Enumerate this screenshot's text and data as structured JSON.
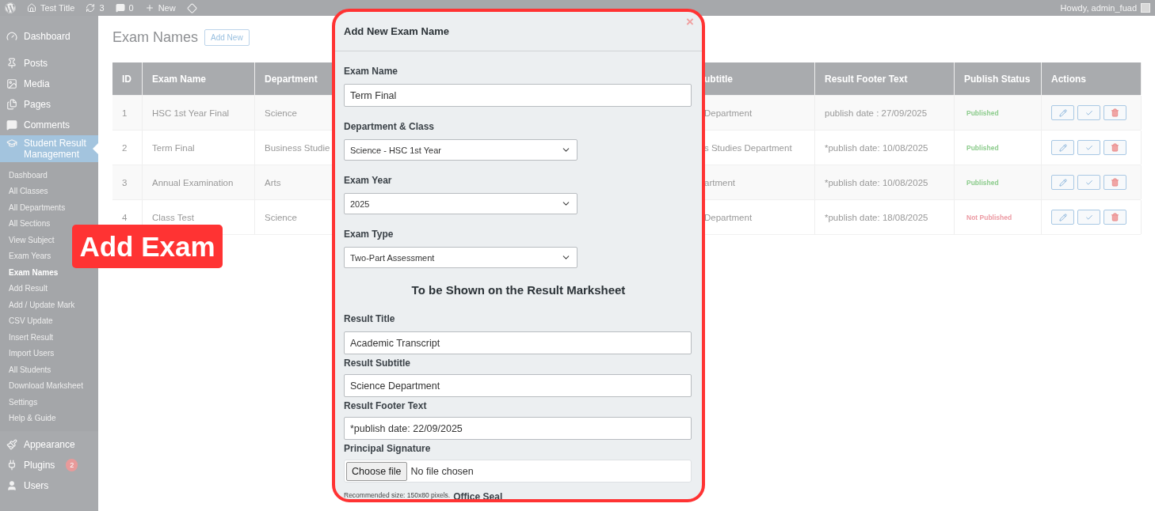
{
  "admin_bar": {
    "site": "Test Title",
    "updates": "3",
    "comments": "0",
    "new": "New",
    "greeting": "Howdy, admin_fuad"
  },
  "sidebar": {
    "items": [
      {
        "label": "Dashboard",
        "selected": false
      },
      {
        "label": "Posts",
        "selected": false
      },
      {
        "label": "Media",
        "selected": false
      },
      {
        "label": "Pages",
        "selected": false
      },
      {
        "label": "Comments",
        "selected": false
      },
      {
        "label": "Student Result Management",
        "selected": true,
        "children": [
          {
            "label": "Dashboard",
            "selected": false
          },
          {
            "label": "All Classes",
            "selected": false
          },
          {
            "label": "All Departments",
            "selected": false
          },
          {
            "label": "All Sections",
            "selected": false
          },
          {
            "label": "View Subject",
            "selected": false
          },
          {
            "label": "Exam Years",
            "selected": false
          },
          {
            "label": "Exam Names",
            "selected": true
          },
          {
            "label": "Add Result",
            "selected": false
          },
          {
            "label": "Add / Update Mark",
            "selected": false
          },
          {
            "label": "CSV Update",
            "selected": false
          },
          {
            "label": "Insert Result",
            "selected": false
          },
          {
            "label": "Import Users",
            "selected": false
          },
          {
            "label": "All Students",
            "selected": false
          },
          {
            "label": "Download Marksheet",
            "selected": false
          },
          {
            "label": "Settings",
            "selected": false
          },
          {
            "label": "Help & Guide",
            "selected": false
          }
        ]
      },
      {
        "label": "Appearance",
        "selected": false
      },
      {
        "label": "Plugins",
        "selected": false,
        "badge": "2"
      },
      {
        "label": "Users",
        "selected": false
      }
    ]
  },
  "page": {
    "title": "Exam Names",
    "add_new": "Add New"
  },
  "table": {
    "columns": [
      "ID",
      "Exam Name",
      "Department",
      "ubtitle",
      "Result Footer Text",
      "Publish Status",
      "Actions"
    ],
    "rows": [
      {
        "id": "1",
        "exam_name": "HSC 1st Year Final",
        "department": "Science",
        "column_4": "Department",
        "footer": "publish date : 27/09/2025",
        "status": "Published",
        "published": true
      },
      {
        "id": "2",
        "exam_name": "Term Final",
        "department": "Business Studie",
        "column_4": "s Studies Department",
        "footer": "*publish date: 10/08/2025",
        "status": "Published",
        "published": true
      },
      {
        "id": "3",
        "exam_name": "Annual Examination",
        "department": "Arts",
        "column_4": "artment",
        "footer": "*publish date: 10/08/2025",
        "status": "Published",
        "published": true
      },
      {
        "id": "4",
        "exam_name": "Class Test",
        "department": "Science",
        "column_4": "Department",
        "footer": "*publish date: 18/08/2025",
        "status": "Not Published",
        "published": false
      }
    ]
  },
  "callout": "Add Exam",
  "modal": {
    "title": "Add New Exam Name",
    "close": "×",
    "fields": [
      {
        "kind": "text",
        "label": "Exam Name",
        "value": "Term Final"
      },
      {
        "kind": "select",
        "label": "Department & Class",
        "value": "Science - HSC 1st Year"
      },
      {
        "kind": "select",
        "label": "Exam Year",
        "value": "2025"
      },
      {
        "kind": "select",
        "label": "Exam Type",
        "value": "Two-Part Assessment"
      },
      {
        "kind": "heading",
        "text": "To be Shown on the Result Marksheet"
      },
      {
        "kind": "text",
        "label": "Result Title",
        "value": "Academic Transcript"
      },
      {
        "kind": "text",
        "label": "Result Subtitle",
        "value": "Science Department"
      },
      {
        "kind": "text",
        "label": "Result Footer Text",
        "value": "*publish date: 22/09/2025"
      },
      {
        "kind": "file",
        "label": "Principal Signature",
        "button": "Choose file",
        "status": "No file chosen"
      },
      {
        "kind": "footnote",
        "hint": "Recommended size: 150x80 pixels.",
        "label": "Office Seal"
      }
    ]
  }
}
